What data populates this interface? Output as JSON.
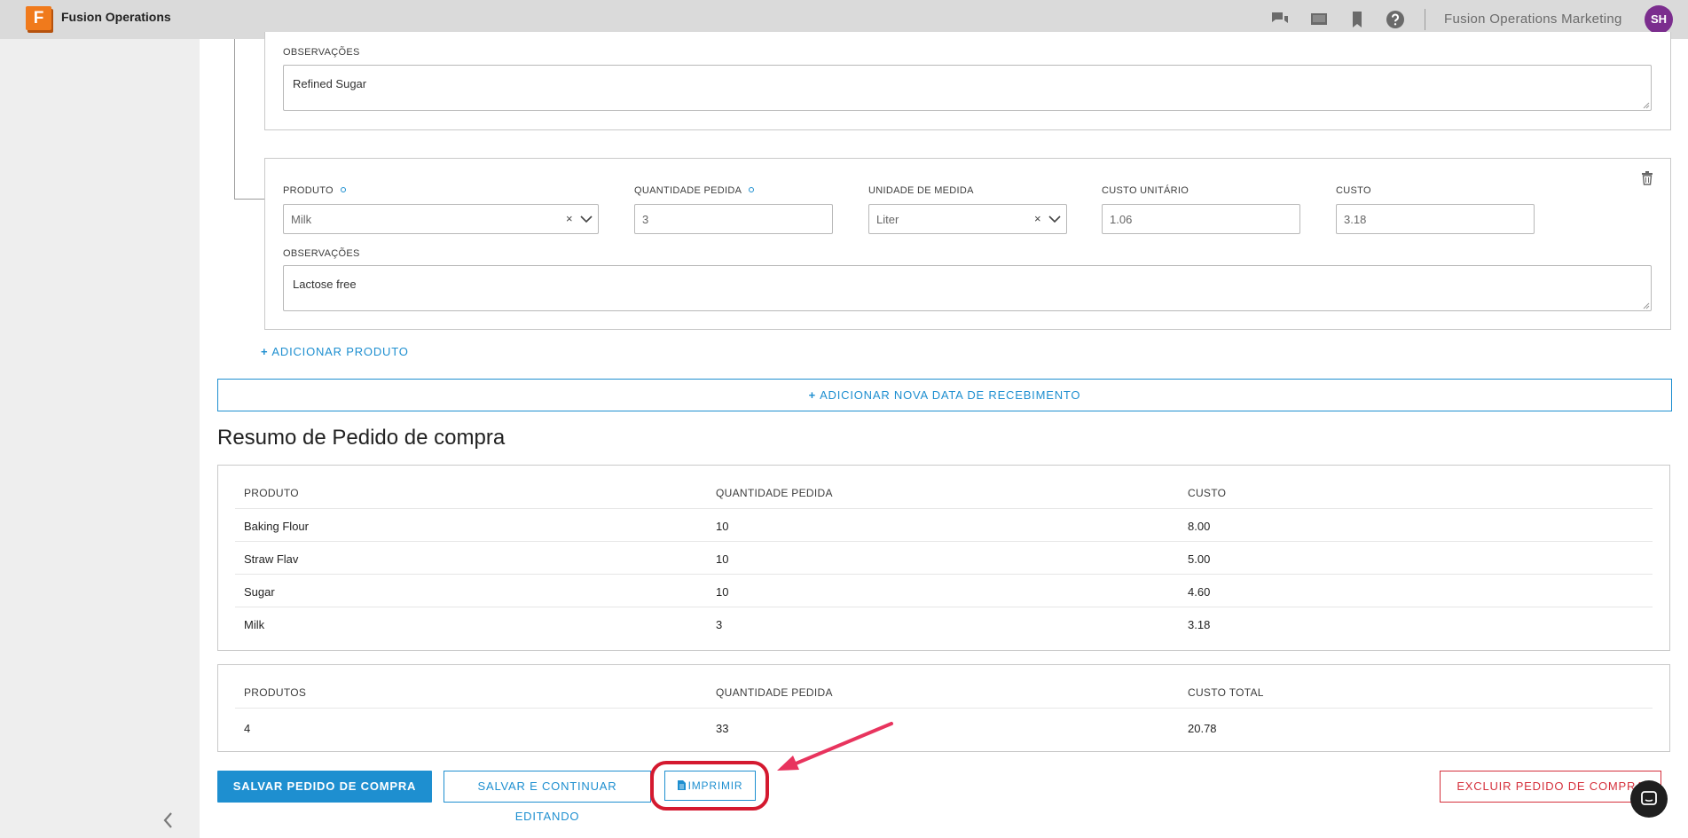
{
  "app": {
    "logo_letter": "F",
    "title": "Fusion Operations",
    "account_name": "Fusion Operations Marketing",
    "user_initials": "SH",
    "icons": [
      "chat-icon",
      "screen-icon",
      "bookmark-icon",
      "help-icon"
    ]
  },
  "line_item_prev": {
    "notes_label": "OBSERVAÇÕES",
    "notes_value": "Refined Sugar"
  },
  "line_item": {
    "product_label": "PRODUTO",
    "product_value": "Milk",
    "qty_label": "QUANTIDADE PEDIDA",
    "qty_value": "3",
    "unit_label": "UNIDADE DE MEDIDA",
    "unit_value": "Liter",
    "unit_cost_label": "CUSTO UNITÁRIO",
    "unit_cost_value": "1.06",
    "cost_label": "CUSTO",
    "cost_value": "3.18",
    "notes_label": "OBSERVAÇÕES",
    "notes_value": "Lactose free",
    "clear_glyph": "×"
  },
  "actions": {
    "add_product": "ADICIONAR PRODUTO",
    "add_receipt_date": "ADICIONAR NOVA DATA DE RECEBIMENTO",
    "plus_glyph": "+"
  },
  "summary": {
    "title": "Resumo de Pedido de compra",
    "columns": [
      "PRODUTO",
      "QUANTIDADE PEDIDA",
      "CUSTO"
    ],
    "rows": [
      [
        "Baking Flour",
        "10",
        "8.00"
      ],
      [
        "Straw Flav",
        "10",
        "5.00"
      ],
      [
        "Sugar",
        "10",
        "4.60"
      ],
      [
        "Milk",
        "3",
        "3.18"
      ]
    ]
  },
  "totals": {
    "columns": [
      "PRODUTOS",
      "QUANTIDADE PEDIDA",
      "CUSTO TOTAL"
    ],
    "row": [
      "4",
      "33",
      "20.78"
    ]
  },
  "footer": {
    "save_label": "SALVAR PEDIDO DE COMPRA",
    "save_continue_label": "SALVAR E CONTINUAR EDITANDO",
    "print_label": "IMPRIMIR",
    "delete_label": "EXCLUIR PEDIDO DE COMPRA"
  },
  "colors": {
    "accent": "#1e8fd0",
    "danger": "#d5303c",
    "annotation": "#d4192f",
    "arrow": "#e8345e"
  }
}
